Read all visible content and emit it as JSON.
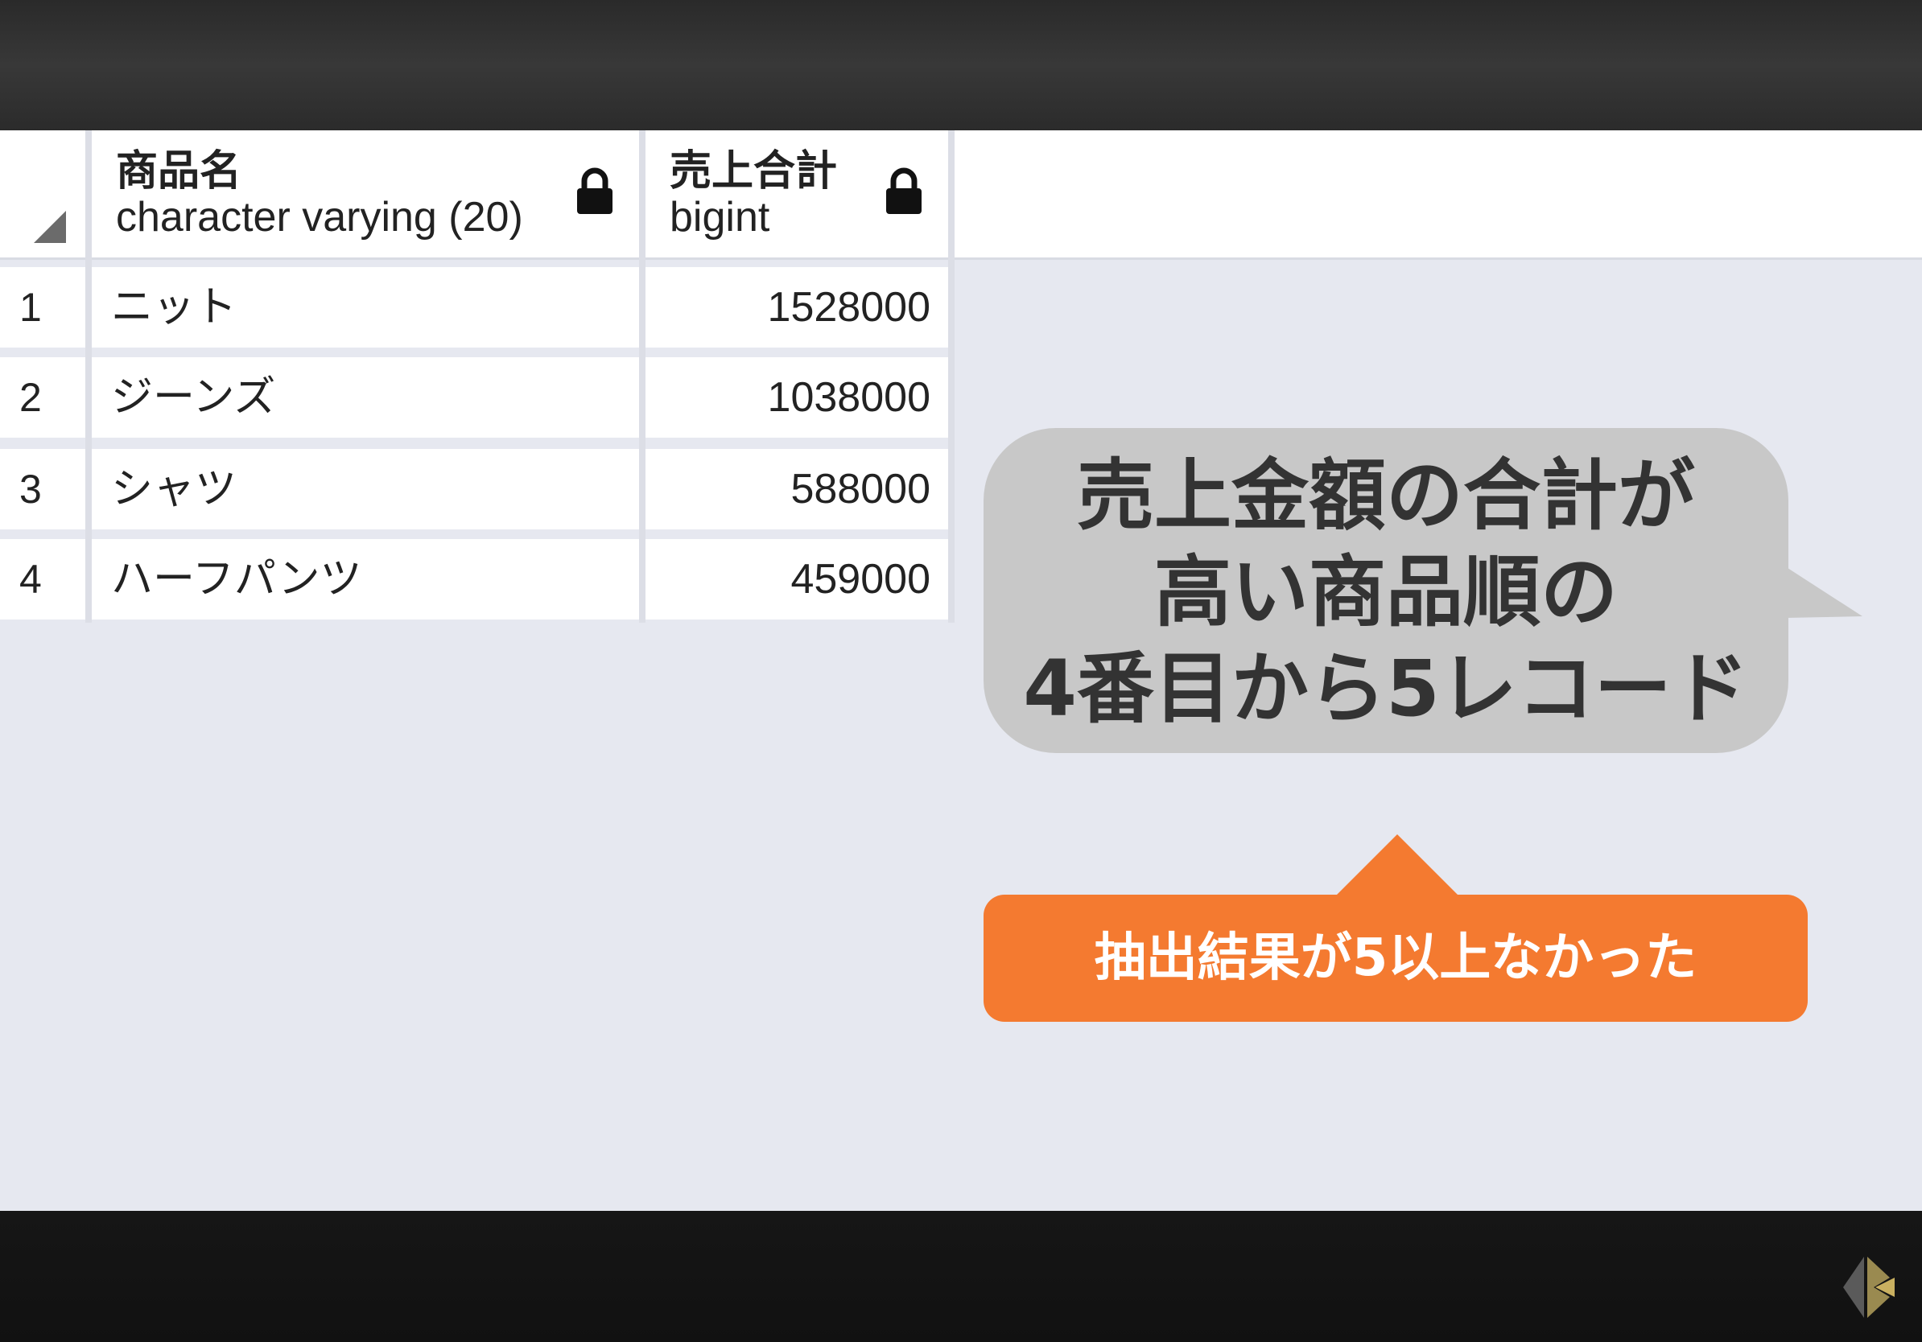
{
  "grid": {
    "columns": [
      {
        "name": "商品名",
        "type": "character varying (20)"
      },
      {
        "name": "売上合計",
        "type": "bigint"
      }
    ],
    "rows": [
      {
        "num": "1",
        "name": "ニット",
        "value": "1528000"
      },
      {
        "num": "2",
        "name": "ジーンズ",
        "value": "1038000"
      },
      {
        "num": "3",
        "name": "シャツ",
        "value": "588000"
      },
      {
        "num": "4",
        "name": "ハーフパンツ",
        "value": "459000"
      }
    ]
  },
  "callout": {
    "lines": [
      "売上金額の合計が",
      "高い商品順の",
      "4番目から5レコード"
    ]
  },
  "note": {
    "text": "抽出結果が5以上なかった"
  },
  "colors": {
    "bubble": "#c8c8c8",
    "accent": "#f47a30",
    "grid_bg": "#e6e8f0"
  },
  "icons": {
    "lock": "lock-icon",
    "logo": "brand-logo-icon"
  }
}
